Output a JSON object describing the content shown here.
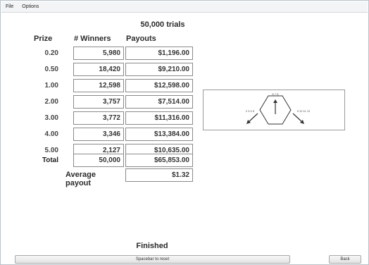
{
  "menu": {
    "file": "File",
    "options": "Options"
  },
  "heading": "50,000 trials",
  "columns": {
    "prize": "Prize",
    "winners": "# Winners",
    "payouts": "Payouts"
  },
  "rows": [
    {
      "prize": "0.20",
      "winners": "5,980",
      "payout": "$1,196.00"
    },
    {
      "prize": "0.50",
      "winners": "18,420",
      "payout": "$9,210.00"
    },
    {
      "prize": "1.00",
      "winners": "12,598",
      "payout": "$12,598.00"
    },
    {
      "prize": "2.00",
      "winners": "3,757",
      "payout": "$7,514.00"
    },
    {
      "prize": "3.00",
      "winners": "3,772",
      "payout": "$11,316.00"
    },
    {
      "prize": "4.00",
      "winners": "3,346",
      "payout": "$13,384.00"
    },
    {
      "prize": "5.00",
      "winners": "2,127",
      "payout": "$10,635.00"
    }
  ],
  "total": {
    "label": "Total",
    "winners": "50,000",
    "payout": "$65,853.00"
  },
  "average": {
    "label": "Average payout",
    "value": "$1.32"
  },
  "diagram": {
    "top_numbers": "6 7 8",
    "left_numbers": "2 3 4 5",
    "right_numbers": "9 10 11 12"
  },
  "status": "Finished",
  "buttons": {
    "reset": "Spacebar to reset",
    "back": "Back"
  },
  "colors": {
    "frame": "#b9c0c8",
    "cell_border": "#8a8a8a",
    "menubar": "#f3f4f6"
  }
}
